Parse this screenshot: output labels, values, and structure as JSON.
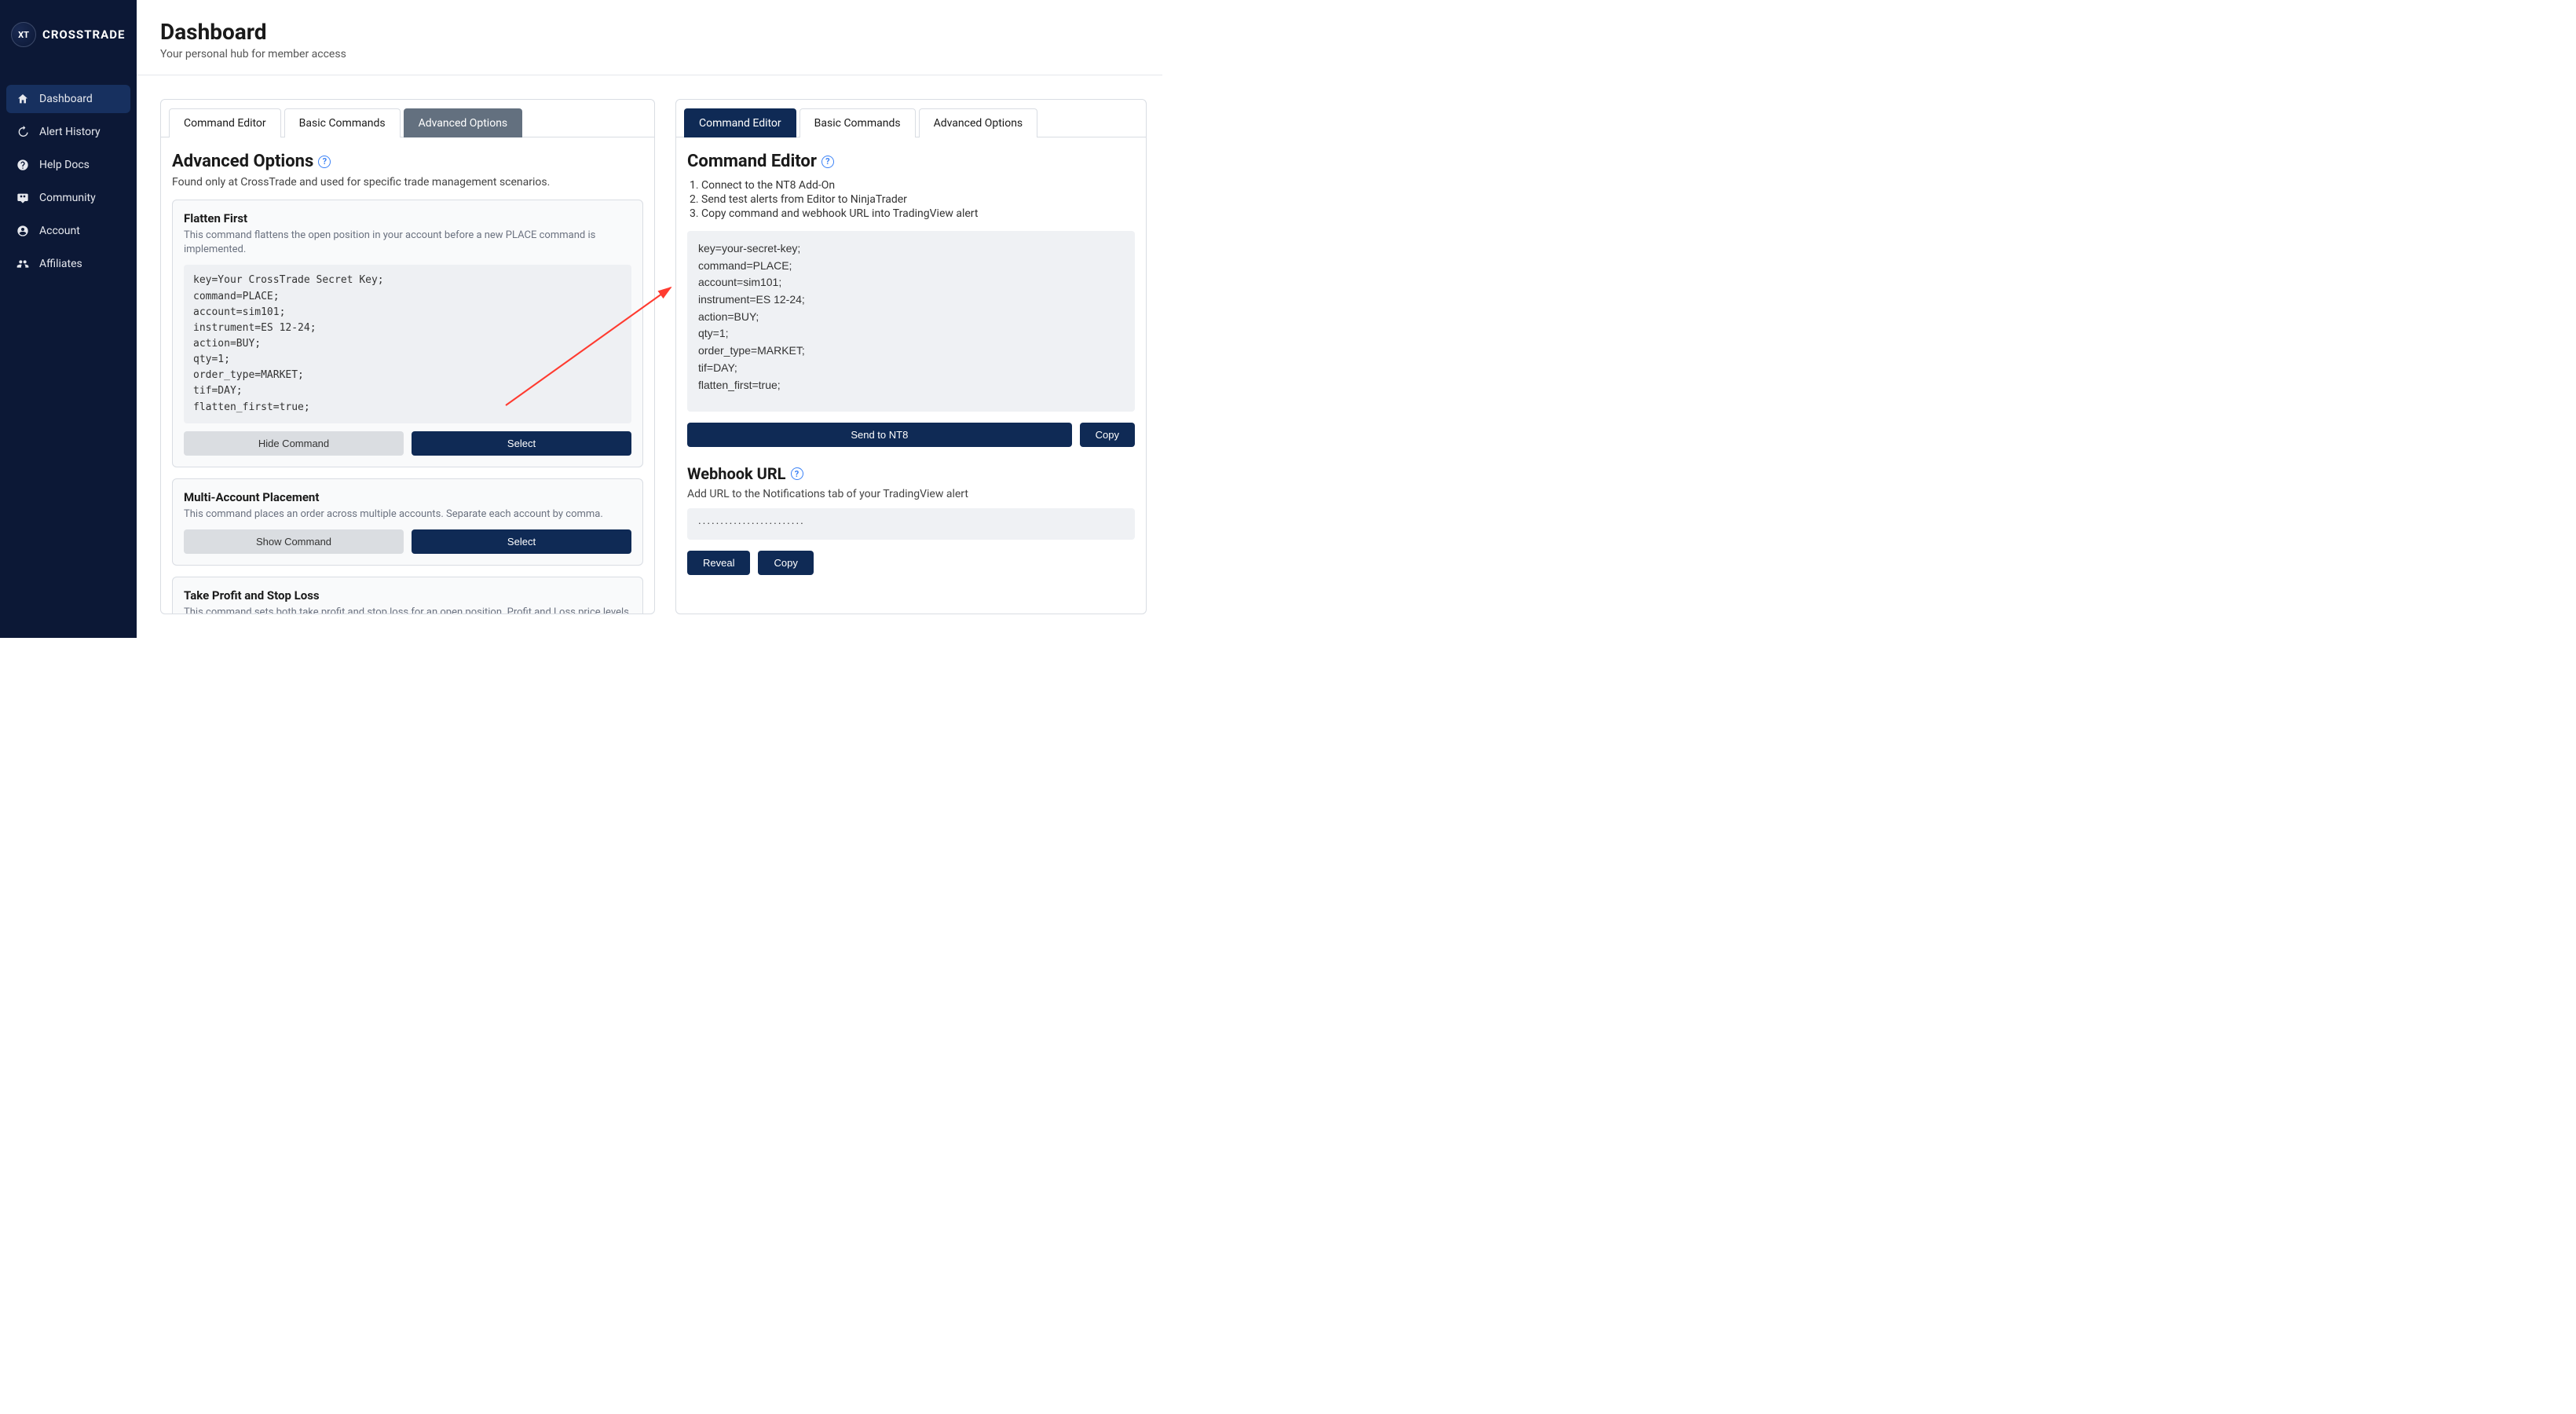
{
  "brand": {
    "badge": "XT",
    "name": "CROSSTRADE"
  },
  "sidebar": {
    "items": [
      {
        "label": "Dashboard"
      },
      {
        "label": "Alert History"
      },
      {
        "label": "Help Docs"
      },
      {
        "label": "Community"
      },
      {
        "label": "Account"
      },
      {
        "label": "Affiliates"
      }
    ]
  },
  "header": {
    "title": "Dashboard",
    "subtitle": "Your personal hub for member access"
  },
  "leftPanel": {
    "tabs": [
      "Command Editor",
      "Basic Commands",
      "Advanced Options"
    ],
    "sectionTitle": "Advanced Options",
    "sectionSub": "Found only at CrossTrade and used for specific trade management scenarios.",
    "cards": [
      {
        "title": "Flatten First",
        "desc": "This command flattens the open position in your account before a new PLACE command is implemented.",
        "code": "key=Your CrossTrade Secret Key;\ncommand=PLACE;\naccount=sim101;\ninstrument=ES 12-24;\naction=BUY;\nqty=1;\norder_type=MARKET;\ntif=DAY;\nflatten_first=true;",
        "hideLabel": "Hide Command",
        "selectLabel": "Select"
      },
      {
        "title": "Multi-Account Placement",
        "desc": "This command places an order across multiple accounts. Separate each account by comma.",
        "showLabel": "Show Command",
        "selectLabel": "Select"
      },
      {
        "title": "Take Profit and Stop Loss",
        "desc": "This command sets both take profit and stop loss for an open position. Profit and Loss price levels can be numerical, percentage, or tick based."
      }
    ]
  },
  "rightPanel": {
    "tabs": [
      "Command Editor",
      "Basic Commands",
      "Advanced Options"
    ],
    "sectionTitle": "Command Editor",
    "steps": [
      "Connect to the NT8 Add-On",
      "Send test alerts from Editor to NinjaTrader",
      "Copy command and webhook URL into TradingView alert"
    ],
    "editorContent": "key=your-secret-key;\ncommand=PLACE;\naccount=sim101;\ninstrument=ES 12-24;\naction=BUY;\nqty=1;\norder_type=MARKET;\ntif=DAY;\nflatten_first=true;",
    "sendLabel": "Send to NT8",
    "copyLabel": "Copy",
    "webhookTitle": "Webhook URL",
    "webhookSub": "Add URL to the Notifications tab of your TradingView alert",
    "webhookMasked": "························",
    "revealLabel": "Reveal",
    "copy2Label": "Copy"
  }
}
